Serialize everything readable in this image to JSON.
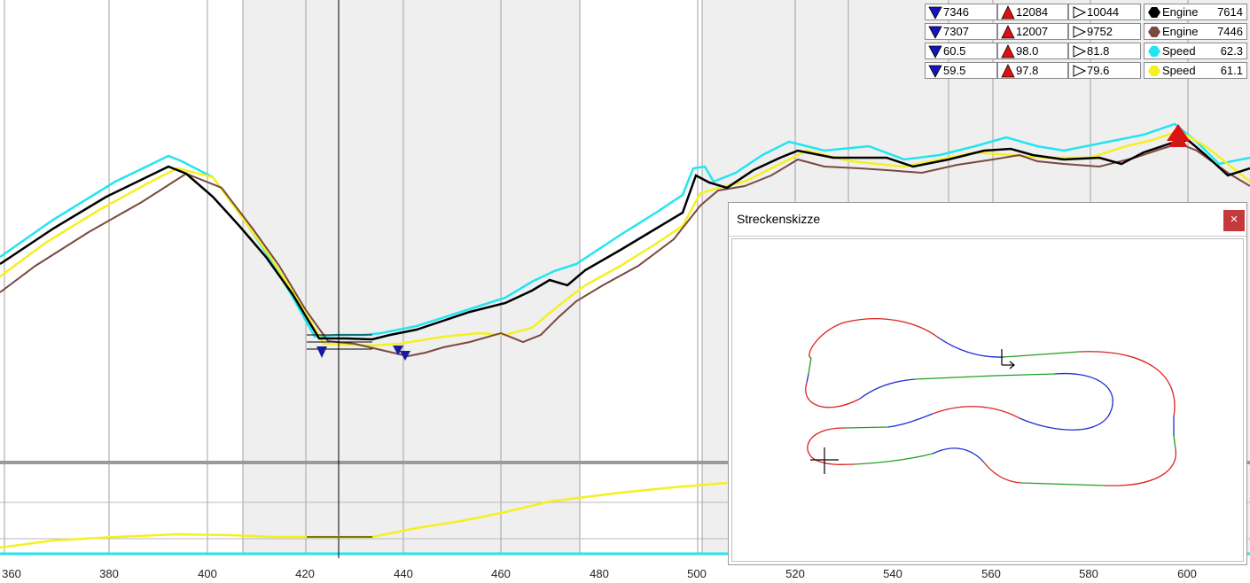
{
  "x_axis": {
    "ticks": [
      "360",
      "380",
      "400",
      "420",
      "440",
      "460",
      "480",
      "500",
      "520",
      "540",
      "560",
      "580",
      "600"
    ]
  },
  "legend": {
    "rows": [
      {
        "min": "7346",
        "max": "12084",
        "cur": "10044",
        "series": "Engine",
        "series_val": "7614",
        "dot": "#000000"
      },
      {
        "min": "7307",
        "max": "12007",
        "cur": "9752",
        "series": "Engine",
        "series_val": "7446",
        "dot": "#7a4a3f"
      },
      {
        "min": "60.5",
        "max": "98.0",
        "cur": "81.8",
        "series": "Speed",
        "series_val": "62.3",
        "dot": "#22e5f0"
      },
      {
        "min": "59.5",
        "max": "97.8",
        "cur": "79.6",
        "series": "Speed",
        "series_val": "61.1",
        "dot": "#f5f020"
      }
    ]
  },
  "track_window": {
    "title": "Streckenskizze",
    "close_label": "×"
  },
  "colors": {
    "black": "#000000",
    "brown": "#7a4a3f",
    "cyan": "#22e5f0",
    "yellow": "#f5f020",
    "shade": "#efefef",
    "grid": "#a0a0a0"
  },
  "icons": {
    "min": "blue-down-triangle-icon",
    "max": "red-up-triangle-icon",
    "cur": "outline-right-triangle-icon"
  }
}
